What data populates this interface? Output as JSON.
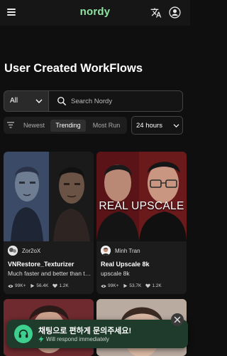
{
  "header": {
    "logo": "nordy",
    "accent": "#8fe3a3",
    "icons": [
      "hamburger-menu-icon",
      "translate-icon",
      "account-icon"
    ]
  },
  "page": {
    "title": "User Created WorkFlows"
  },
  "search": {
    "scope_value": "All",
    "placeholder": "Search Nordy"
  },
  "filters": {
    "tabs": [
      {
        "label": "Newest",
        "active": false
      },
      {
        "label": "Trending",
        "active": true
      },
      {
        "label": "Most Run",
        "active": false
      }
    ],
    "period_value": "24 hours"
  },
  "cards": [
    {
      "image_caption": "",
      "author": "Zor2oX",
      "title": "VNRestore_Texturizer",
      "description": "Much faster and better than the original",
      "runs": "99K+",
      "views": "56.4K",
      "likes": "1.2K"
    },
    {
      "image_caption": "REAL UPSCALE",
      "author": "Minh Tran",
      "title": "Real Upscale 8k",
      "description": "upscale 8k",
      "runs": "99K+",
      "views": "53.7K",
      "likes": "1.2K"
    }
  ],
  "chat_widget": {
    "title": "채팅으로 편하게 문의주세요!",
    "subtitle": "Will respond immediately",
    "accent": "#3ecf8e"
  }
}
